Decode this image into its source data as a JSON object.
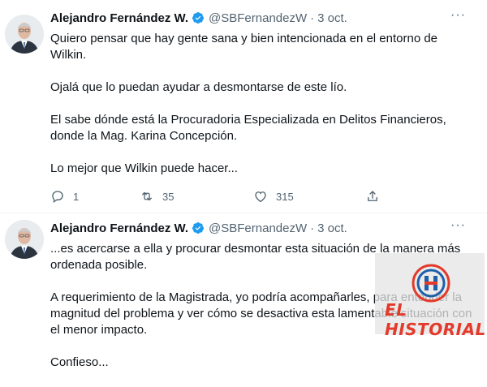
{
  "tweets": [
    {
      "author_name": "Alejandro Fernández W.",
      "handle": "@SBFernandezW",
      "separator": "·",
      "time": "3 oct.",
      "more": "···",
      "paragraphs": [
        "Quiero pensar que hay gente sana y bien intencionada en el entorno de Wilkin.",
        "Ojalá que lo puedan ayudar a desmontarse de este lío.",
        "El sabe dónde está la Procuradoria Especializada en Delitos Financieros, donde la Mag. Karina Concepción.",
        "Lo mejor que Wilkin puede hacer..."
      ],
      "actions": {
        "reply_count": "1",
        "retweet_count": "35",
        "like_count": "315"
      }
    },
    {
      "author_name": "Alejandro Fernández W.",
      "handle": "@SBFernandezW",
      "separator": "·",
      "time": "3 oct.",
      "more": "···",
      "paragraphs": [
        "...es acercarse a ella y procurar desmontar esta situación de la manera más ordenada posible.",
        "A requerimiento de la Magistrada, yo podría acompañarles, para entender la magnitud del problema y ver cómo se desactiva esta lamentable situación con el menor impacto.",
        "Confieso..."
      ]
    }
  ],
  "watermark": {
    "text": "EL HISTORIAL"
  },
  "colors": {
    "verified": "#1d9bf0",
    "muted": "#536471",
    "watermark_red": "#e23a2b",
    "watermark_blue": "#1d5fa8"
  },
  "icons": [
    "verified-badge-icon",
    "more-icon",
    "reply-icon",
    "retweet-icon",
    "like-icon",
    "share-icon"
  ]
}
